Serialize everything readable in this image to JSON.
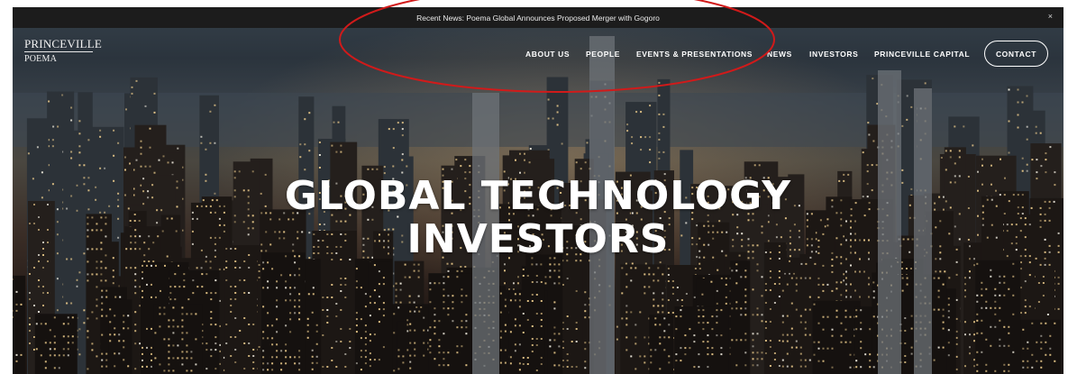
{
  "news_bar": {
    "text": "Recent News: Poema Global Announces Proposed Merger with Gogoro",
    "close_symbol": "×"
  },
  "logo": {
    "line1": "PRINCEVILLE",
    "line2": "POEMA"
  },
  "nav": {
    "items": [
      {
        "label": "ABOUT US"
      },
      {
        "label": "PEOPLE"
      },
      {
        "label": "EVENTS & PRESENTATIONS"
      },
      {
        "label": "NEWS"
      },
      {
        "label": "INVESTORS"
      },
      {
        "label": "PRINCEVILLE CAPITAL"
      }
    ],
    "contact_label": "CONTACT"
  },
  "hero": {
    "headline_line1": "GLOBAL TECHNOLOGY",
    "headline_line2": "INVESTORS"
  },
  "colors": {
    "news_bar_bg": "#1c1c1c",
    "annotation": "#d11a1a"
  }
}
